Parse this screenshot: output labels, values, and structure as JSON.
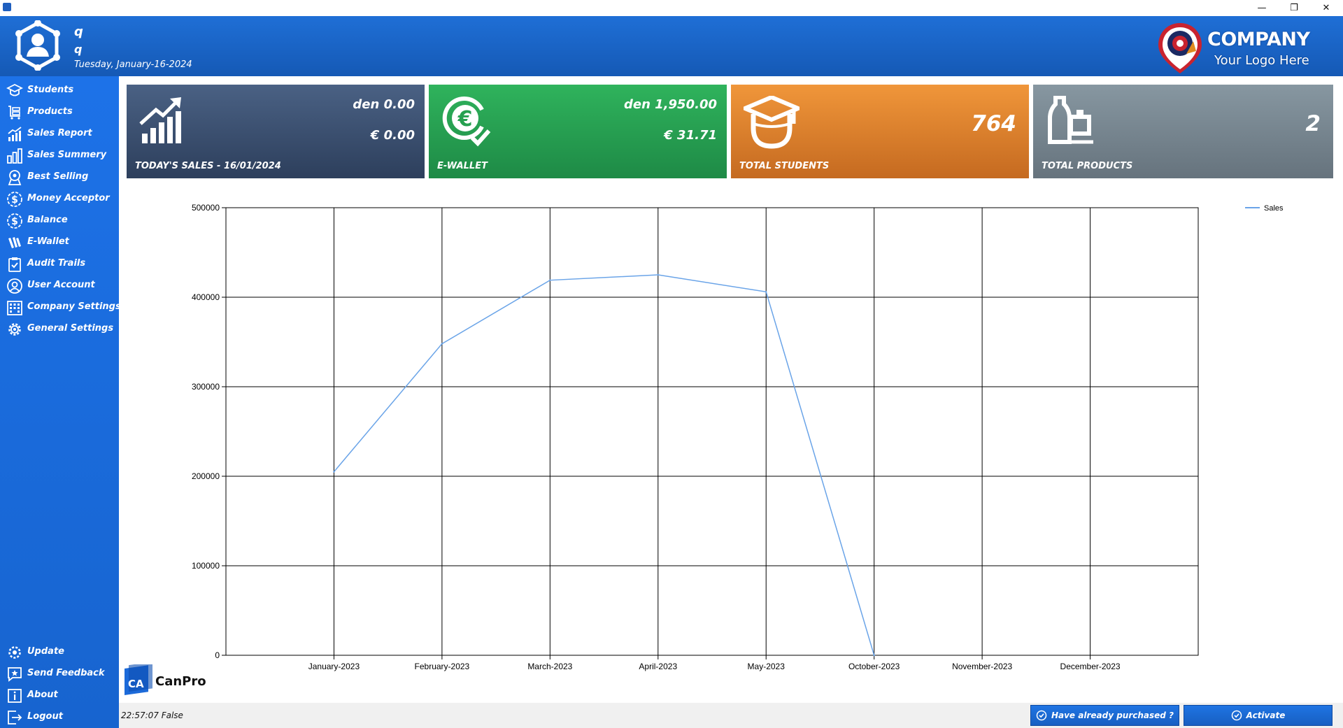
{
  "window": {
    "minimize": "—",
    "restore": "❐",
    "close": "✕"
  },
  "header": {
    "user_name": "q",
    "user_role": "q",
    "date": "Tuesday, January-16-2024",
    "logo_company": "COMPANY",
    "logo_tagline": "Your Logo Here"
  },
  "sidebar": {
    "items": [
      {
        "label": "Students",
        "icon": "graduation-cap-icon"
      },
      {
        "label": "Products",
        "icon": "cart-icon"
      },
      {
        "label": "Sales Report",
        "icon": "sales-report-icon"
      },
      {
        "label": "Sales Summery",
        "icon": "bar-chart-icon"
      },
      {
        "label": "Best Selling",
        "icon": "award-icon"
      },
      {
        "label": "Money Acceptor",
        "icon": "dollar-circle-icon"
      },
      {
        "label": "Balance",
        "icon": "dollar-circle-icon"
      },
      {
        "label": "E-Wallet",
        "icon": "wallet-icon"
      },
      {
        "label": "Audit Trails",
        "icon": "clipboard-check-icon"
      },
      {
        "label": "User Account",
        "icon": "user-circle-icon"
      },
      {
        "label": "Company Settings",
        "icon": "building-icon"
      },
      {
        "label": "General Settings",
        "icon": "gear-icon"
      }
    ],
    "bottom_items": [
      {
        "label": "Update",
        "icon": "update-icon"
      },
      {
        "label": "Send Feedback",
        "icon": "feedback-icon"
      },
      {
        "label": "About",
        "icon": "info-icon"
      },
      {
        "label": "Logout",
        "icon": "logout-icon"
      }
    ]
  },
  "cards": {
    "sales": {
      "line1": "den 0.00",
      "line2": "€ 0.00",
      "title": "TODAY'S SALES - 16/01/2024",
      "icon": "trending-up-chart-icon"
    },
    "wallet": {
      "line1": "den 1,950.00",
      "line2": "€ 31.71",
      "title": "E-WALLET",
      "icon": "euro-check-icon"
    },
    "students": {
      "value": "764",
      "title": "TOTAL STUDENTS",
      "icon": "student-icon"
    },
    "products": {
      "value": "2",
      "title": "TOTAL PRODUCTS",
      "icon": "products-icon"
    }
  },
  "chart_data": {
    "type": "line",
    "categories": [
      "January-2023",
      "February-2023",
      "March-2023",
      "April-2023",
      "May-2023",
      "October-2023",
      "November-2023",
      "December-2023"
    ],
    "series": [
      {
        "name": "Sales",
        "values": [
          205000,
          348000,
          419000,
          425000,
          406000,
          0,
          null,
          null
        ],
        "color": "#6aa4e8"
      }
    ],
    "ylim": [
      0,
      500000
    ],
    "yticks": [
      "0",
      "100000",
      "200000",
      "300000",
      "400000",
      "500000"
    ],
    "grid": true,
    "legend": "top-right"
  },
  "footer": {
    "brand": "CanPro",
    "brand_badge": "CA",
    "status": "22:57:07  False",
    "purchased_label": "Have already purchased ?",
    "activate_label": "Activate"
  },
  "colors": {
    "sidebar": "#1d72e8",
    "header": "#1f6fd6",
    "card_sales": "#3b5070",
    "card_wallet": "#27a04f",
    "card_students": "#e0832e",
    "card_products": "#76848e"
  }
}
